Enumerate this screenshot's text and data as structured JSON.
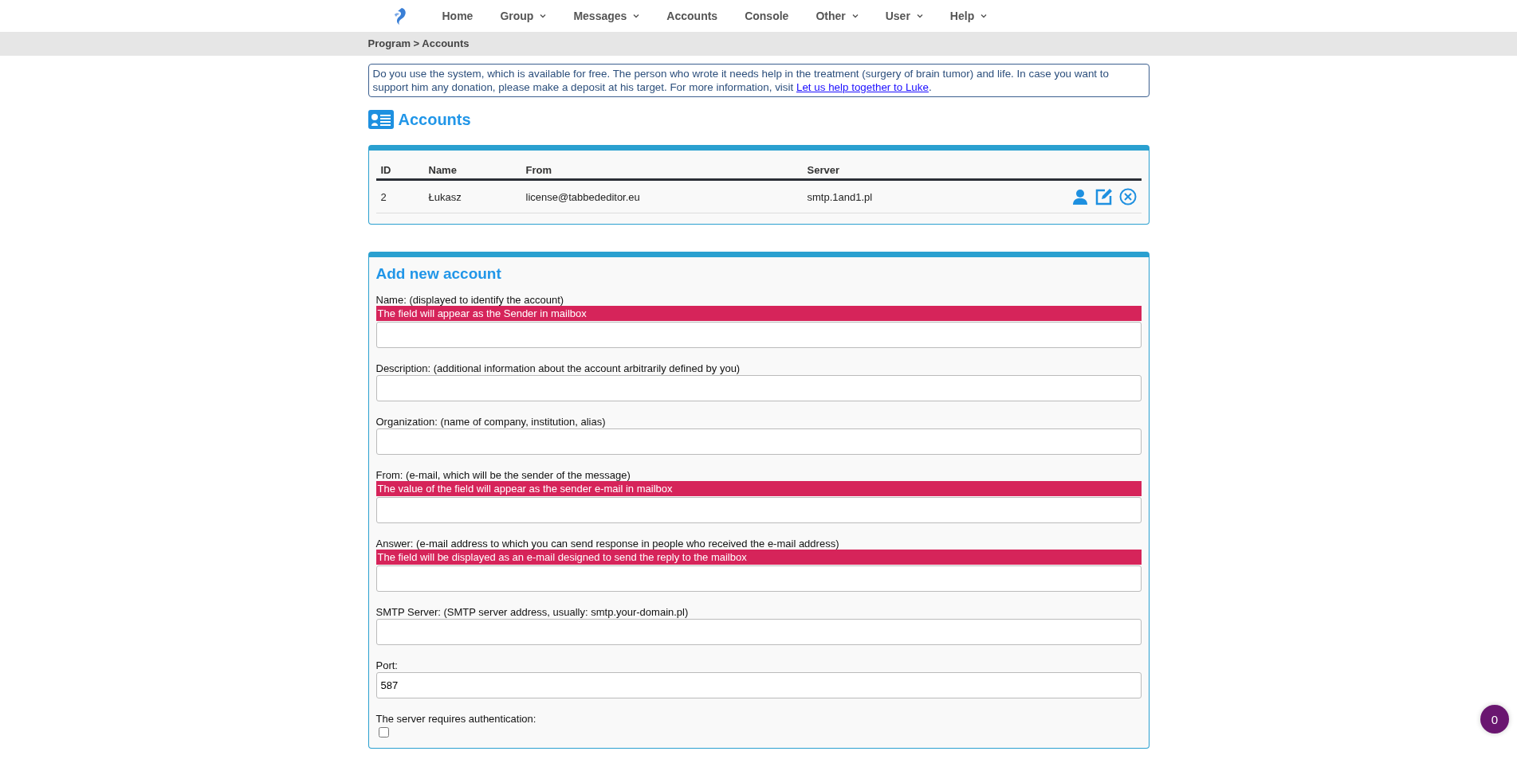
{
  "nav": {
    "items": [
      {
        "label": "Home",
        "dropdown": false
      },
      {
        "label": "Group",
        "dropdown": true
      },
      {
        "label": "Messages",
        "dropdown": true
      },
      {
        "label": "Accounts",
        "dropdown": false
      },
      {
        "label": "Console",
        "dropdown": false
      },
      {
        "label": "Other",
        "dropdown": true
      },
      {
        "label": "User",
        "dropdown": true
      },
      {
        "label": "Help",
        "dropdown": true
      }
    ]
  },
  "breadcrumb": "Program > Accounts",
  "notice": {
    "text": "Do you use the system, which is available for free. The person who wrote it needs help in the treatment (surgery of brain tumor) and life. In case you want to support him any donation, please make a deposit at his target. For more information, visit ",
    "link": "Let us help together to Luke",
    "after": "."
  },
  "page_title": "Accounts",
  "table": {
    "columns": [
      "ID",
      "Name",
      "From",
      "Server"
    ],
    "rows": [
      {
        "cells": [
          "2",
          "Łukasz",
          "license@tabbededitor.eu",
          "smtp.1and1.pl"
        ]
      }
    ]
  },
  "form": {
    "title": "Add new account",
    "fields": [
      {
        "kind": "text",
        "label": "Name: (displayed to identify the account)",
        "hint": "The field will appear as the Sender in mailbox"
      },
      {
        "kind": "text",
        "label": "Description: (additional information about the account arbitrarily defined by you)"
      },
      {
        "kind": "text",
        "label": "Organization: (name of company, institution, alias)"
      },
      {
        "kind": "text",
        "label": "From: (e-mail, which will be the sender of the message)",
        "hint": "The value of the field will appear as the sender e-mail in mailbox"
      },
      {
        "kind": "text",
        "label": "Answer: (e-mail address to which you can send response in people who received the e-mail address)",
        "hint": "The field will be displayed as an e-mail designed to send the reply to the mailbox"
      },
      {
        "kind": "text",
        "label": "SMTP Server: (SMTP server address, usually: smtp.your-domain.pl)"
      },
      {
        "kind": "text",
        "label": "Port:",
        "value": "587"
      },
      {
        "kind": "checkbox",
        "label": "The server requires authentication:",
        "checked": false
      }
    ]
  },
  "badge": "0"
}
